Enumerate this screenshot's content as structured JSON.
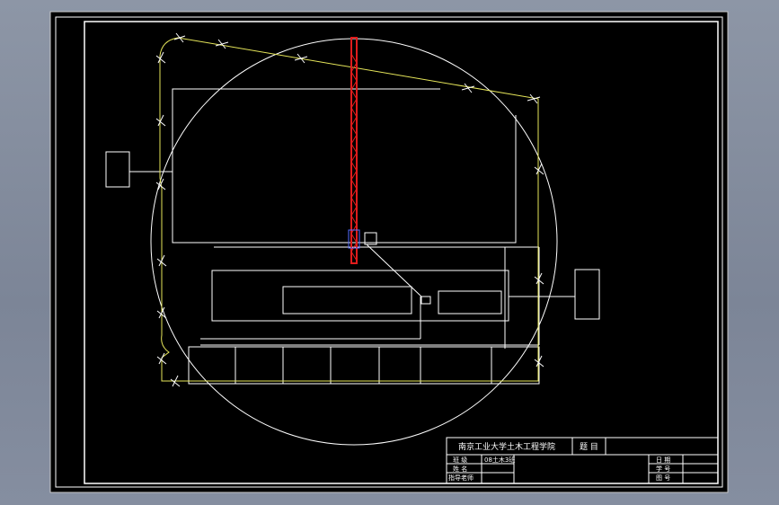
{
  "drawing": {
    "background_color": "#000000",
    "line_color": "#ffffff",
    "fence_color": "#e6e65a",
    "crane_color": "#e01c1c"
  },
  "title_block": {
    "institution": "南京工业大学土木工程学院",
    "title_label": "题 目",
    "title_value": "",
    "row1_label": "班 级",
    "row1_value": "08土木3班",
    "row2_label": "姓 名",
    "row2_value": "",
    "row3_label": "指导老师",
    "row3_value": "",
    "right1_label": "日 期",
    "right1_value": "",
    "right2_label": "学 号",
    "right2_value": "",
    "right3_label": "图 号",
    "right3_value": ""
  }
}
